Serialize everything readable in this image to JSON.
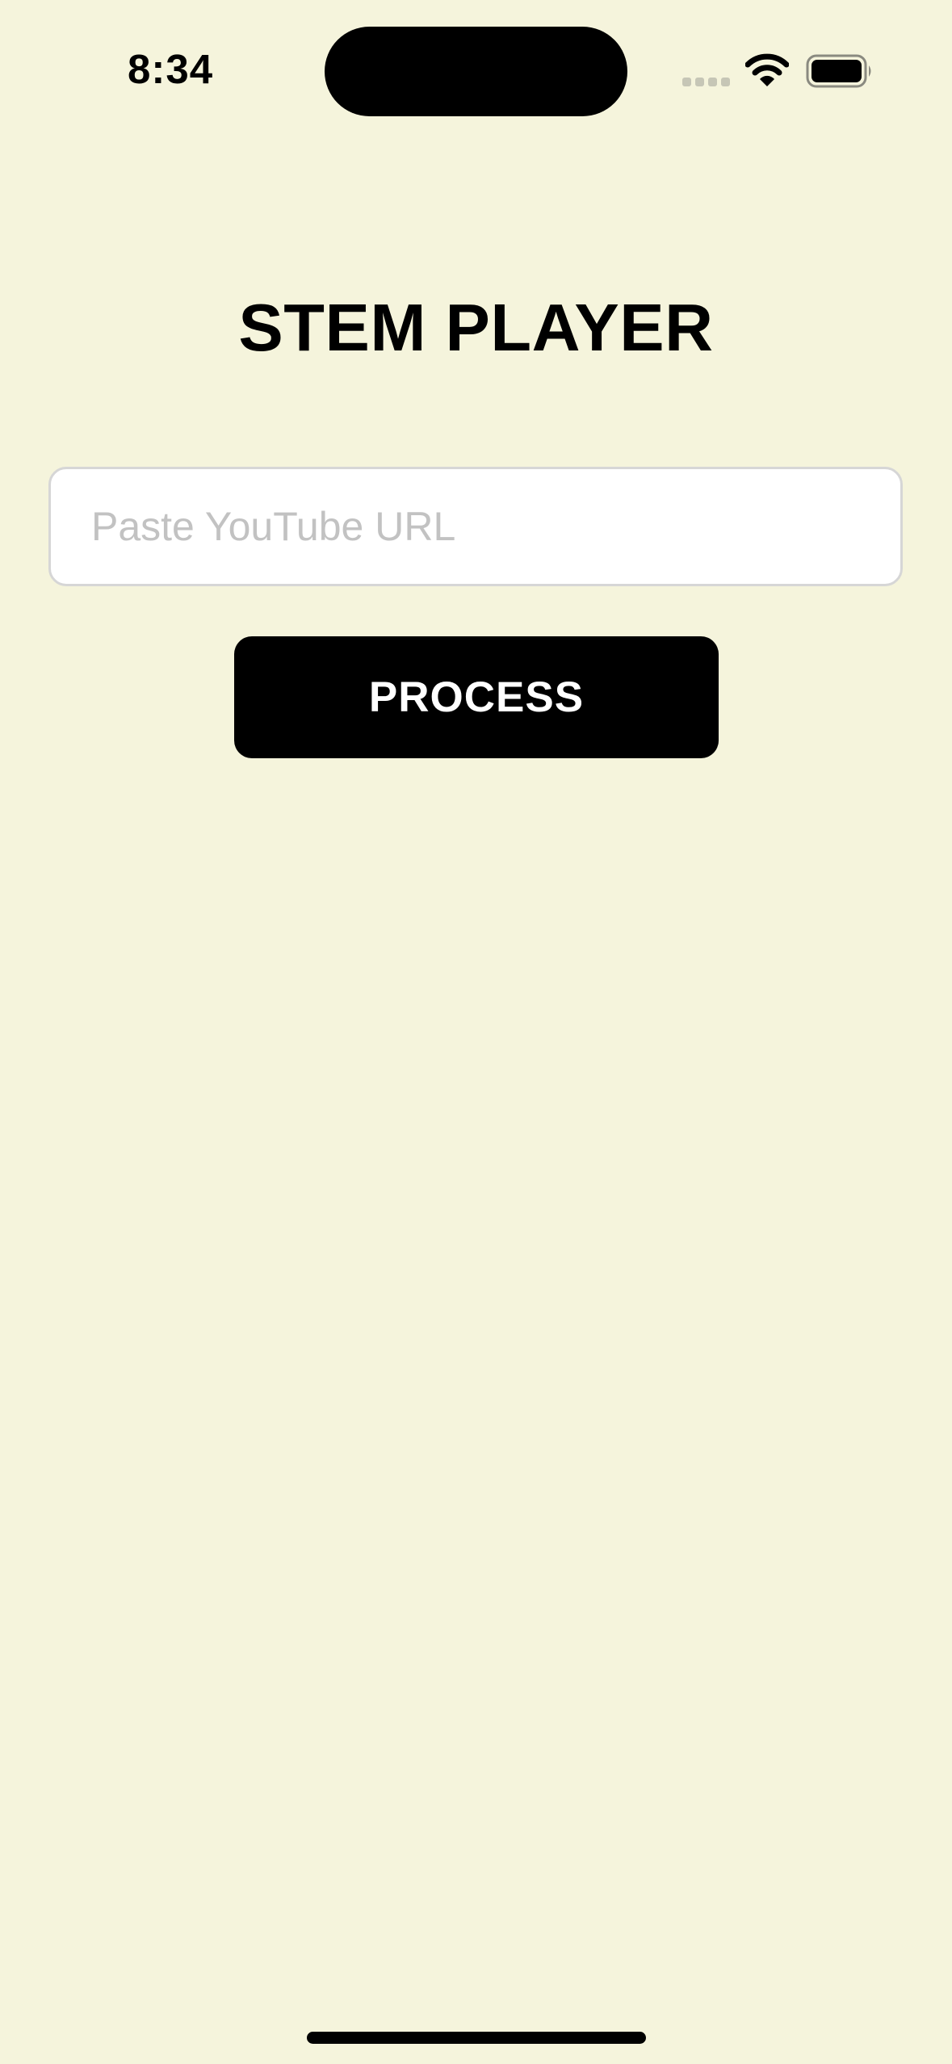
{
  "status_bar": {
    "time": "8:34",
    "icons": [
      "signal-icon",
      "wifi-icon",
      "battery-icon"
    ]
  },
  "app": {
    "title": "STEM PLAYER"
  },
  "url_input": {
    "value": "",
    "placeholder": "Paste YouTube URL"
  },
  "process_button": {
    "label": "PROCESS"
  },
  "colors": {
    "background": "#f5f4dc",
    "button": "#000000",
    "button_text": "#ffffff",
    "placeholder": "#c2c2c2",
    "input_border": "#d6d6d6"
  }
}
